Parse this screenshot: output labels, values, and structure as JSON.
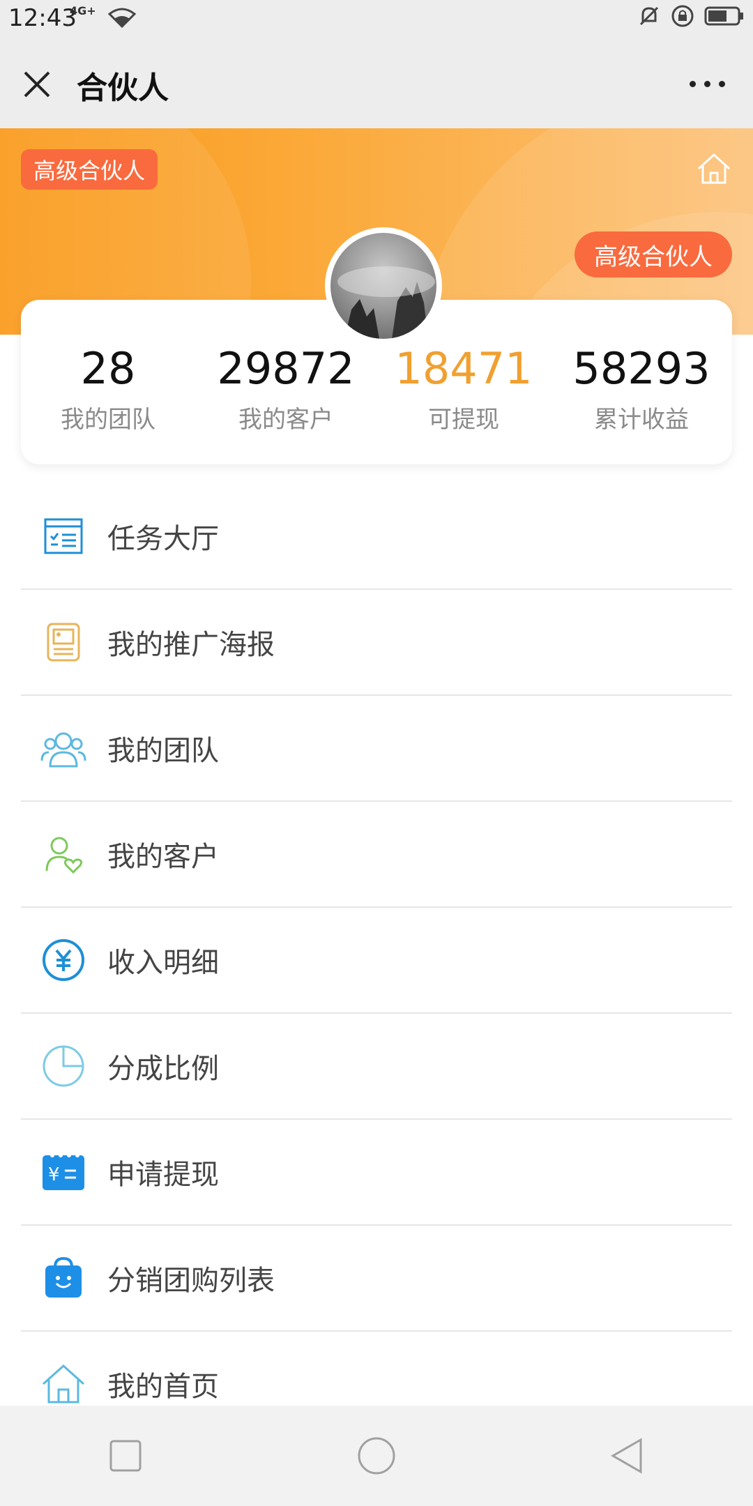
{
  "status_bar": {
    "time": "12:43",
    "network": "4G+"
  },
  "nav": {
    "title": "合伙人"
  },
  "banner": {
    "badge_left": "高级合伙人",
    "badge_right": "高级合伙人"
  },
  "stats": [
    {
      "value": "28",
      "label": "我的团队"
    },
    {
      "value": "29872",
      "label": "我的客户"
    },
    {
      "value": "18471",
      "label": "可提现"
    },
    {
      "value": "58293",
      "label": "累计收益"
    }
  ],
  "menu": [
    {
      "label": "任务大厅",
      "icon": "task-list-icon"
    },
    {
      "label": "我的推广海报",
      "icon": "poster-icon"
    },
    {
      "label": "我的团队",
      "icon": "team-icon"
    },
    {
      "label": "我的客户",
      "icon": "customer-icon"
    },
    {
      "label": "收入明细",
      "icon": "yuan-icon"
    },
    {
      "label": "分成比例",
      "icon": "pie-chart-icon"
    },
    {
      "label": "申请提现",
      "icon": "withdraw-icon"
    },
    {
      "label": "分销团购列表",
      "icon": "shopping-bag-icon"
    },
    {
      "label": "我的首页",
      "icon": "home-icon"
    }
  ],
  "colors": {
    "accent": "#f0a030",
    "badge": "#f96a3e",
    "banner_start": "#fa9a1b",
    "banner_end": "#fcc178"
  }
}
